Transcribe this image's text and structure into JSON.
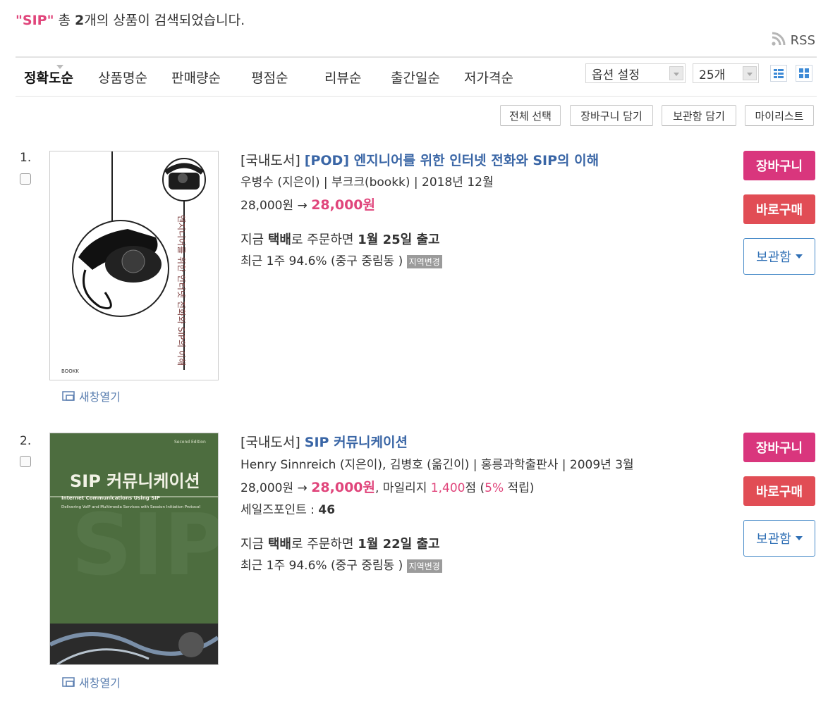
{
  "search": {
    "query": "\"SIP\"",
    "text1": " 총 ",
    "count": "2",
    "text2": "개의 상품이 검색되었습니다."
  },
  "rss": {
    "label": "RSS",
    "icon": "rss-icon"
  },
  "sort": {
    "options": [
      "정확도순",
      "상품명순",
      "판매량순",
      "평점순",
      "리뷰순",
      "출간일순",
      "저가격순"
    ],
    "active": "정확도순",
    "option_select": "옵션 설정",
    "per_page": "25개"
  },
  "actions": {
    "select_all": "전체 선택",
    "add_cart": "장바구니 담기",
    "add_keep": "보관함 담기",
    "mylist": "마이리스트"
  },
  "colors": {
    "accent_pink": "#d9367d",
    "buy_red": "#e14d55",
    "title_blue": "#3a66a6",
    "price_red": "#e0457b"
  },
  "items": [
    {
      "num": "1.",
      "category": "[국내도서]",
      "title": "[POD] 엔지니어를 위한 인터넷 전화와 SIP의 이해",
      "meta": "우병수 (지은이) | 부크크(bookk) | 2018년 12월",
      "list_price": "28,000원",
      "arrow": " → ",
      "sale_price": "28,000원",
      "delivery_pre": "지금 ",
      "delivery_method": "택배",
      "delivery_mid": "로 주문하면 ",
      "delivery_date": "1월 25일 출고",
      "stock": "최근 1주 94.6% (중구 중림동 ) ",
      "region_tag": "지역변경",
      "new_window": "새창열기",
      "cover_text": "엔지니어를 위한 인터넷 전화와 SIP의 이해",
      "cover_publisher": "BOOKK",
      "cart": "장바구니",
      "buy": "바로구매",
      "keep": "보관함"
    },
    {
      "num": "2.",
      "category": "[국내도서]",
      "title": "SIP 커뮤니케이션",
      "meta": "Henry Sinnreich (지은이), 김병호 (옮긴이) | 홍릉과학출판사 | 2009년 3월",
      "list_price": "28,000원",
      "arrow": " → ",
      "sale_price": "28,000원",
      "mileage_pre": ", 마일리지 ",
      "mileage": "1,400",
      "mileage_unit": "점 (",
      "mileage_rate": "5%",
      "mileage_post": " 적립)",
      "salespoint_label": "세일즈포인트 : ",
      "salespoint": "46",
      "delivery_pre": "지금 ",
      "delivery_method": "택배",
      "delivery_mid": "로 주문하면 ",
      "delivery_date": "1월 22일 출고",
      "stock": "최근 1주 94.6% (중구 중림동 ) ",
      "region_tag": "지역변경",
      "new_window": "새창열기",
      "cover_edition": "Second Edition",
      "cover_title": "SIP 커뮤니케이션",
      "cover_sub": "Internet Communications Using SIP",
      "cover_desc": "Delivering VoIP and Multimedia Services with Session Initiation Protocol",
      "cart": "장바구니",
      "buy": "바로구매",
      "keep": "보관함"
    }
  ]
}
